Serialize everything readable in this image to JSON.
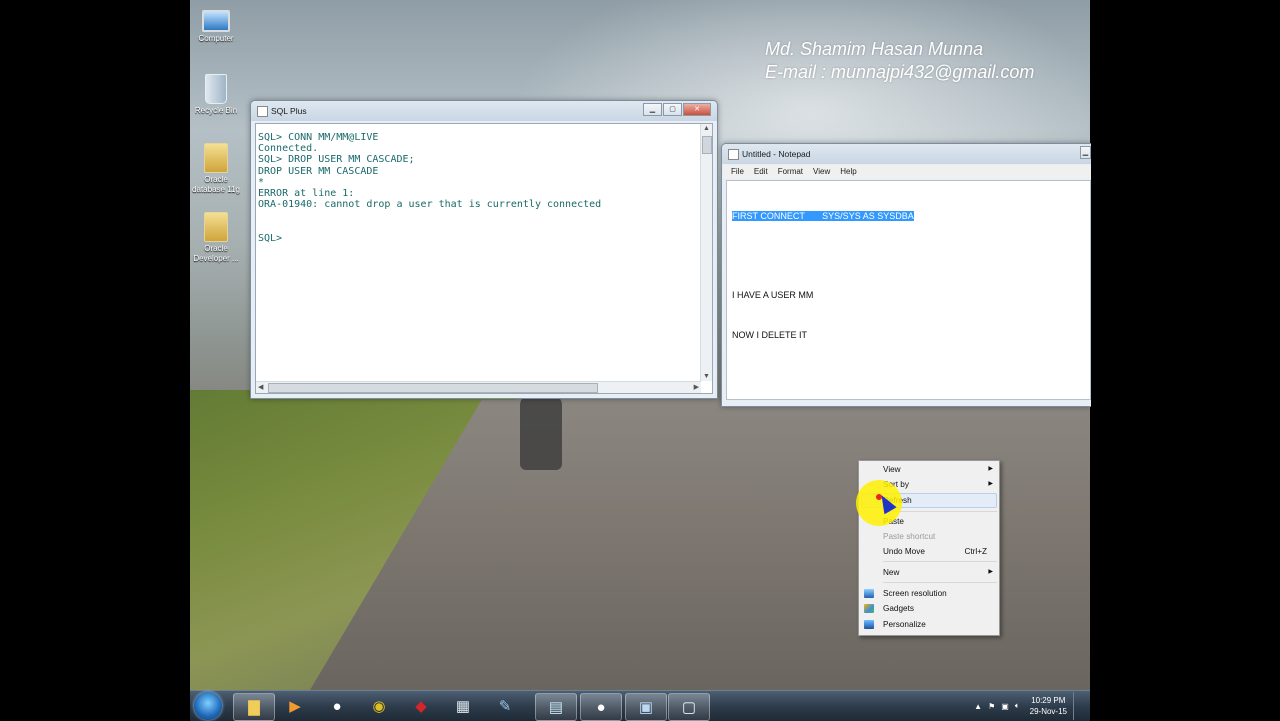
{
  "watermark": {
    "name": "Md. Shamim Hasan Munna",
    "email": "E-mail : munnajpi432@gmail.com"
  },
  "desktop_icons": [
    {
      "label": "Computer",
      "icon": "computer-icon"
    },
    {
      "label": "Recycle Bin",
      "icon": "recycle-bin-icon"
    },
    {
      "label": "Oracle database 11g",
      "icon": "folder-icon"
    },
    {
      "label": "Oracle Developer ...",
      "icon": "folder-icon"
    }
  ],
  "sqlplus": {
    "title": "SQL Plus",
    "lines": [
      "SQL> CONN MM/MM@LIVE",
      "Connected.",
      "SQL> DROP USER MM CASCADE;",
      "DROP USER MM CASCADE",
      "*",
      "ERROR at line 1:",
      "ORA-01940: cannot drop a user that is currently connected",
      "",
      "",
      "SQL>"
    ]
  },
  "notepad": {
    "title": "Untitled - Notepad",
    "menu": [
      "File",
      "Edit",
      "Format",
      "View",
      "Help"
    ],
    "selected_line": "FIRST CONNECT       SYS/SYS AS SYSDBA",
    "lines": [
      "",
      "I HAVE A USER MM",
      "NOW I DELETE IT"
    ]
  },
  "context_menu": {
    "items": [
      {
        "label": "View",
        "submenu": true
      },
      {
        "label": "Sort by",
        "submenu": true
      },
      {
        "label": "Refresh",
        "highlighted": true
      },
      {
        "label": "Paste"
      },
      {
        "label": "Paste shortcut",
        "disabled": true
      },
      {
        "label": "Undo Move",
        "shortcut": "Ctrl+Z"
      },
      {
        "label": "New",
        "submenu": true
      },
      {
        "label": "Screen resolution",
        "icon": "monitor-icon"
      },
      {
        "label": "Gadgets",
        "icon": "gadgets-icon"
      },
      {
        "label": "Personalize",
        "icon": "personalize-icon"
      }
    ]
  },
  "taskbar": {
    "pinned": [
      "explorer-icon",
      "media-player-icon",
      "panda-icon",
      "chrome-icon",
      "book-icon",
      "calculator-icon",
      "paint-icon",
      "notepad-icon",
      "panda-icon",
      "sqlplus-icon",
      "window-icon"
    ],
    "clock_time": "10:29 PM",
    "clock_date": "29-Nov-15"
  },
  "colors": {
    "selection": "#3399ff",
    "sql_text": "#1a6a6a",
    "cursor_highlight": "#fff000"
  }
}
